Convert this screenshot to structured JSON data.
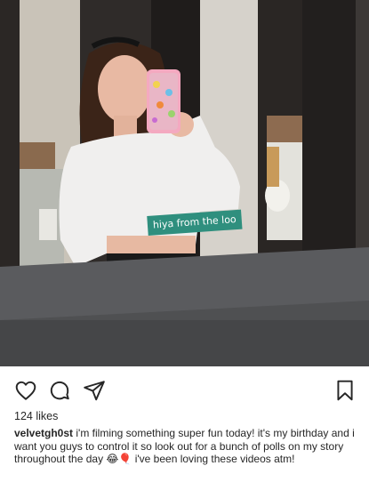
{
  "post": {
    "photo_overlay_text": "hiya from the loo",
    "likes": "124 likes",
    "username": "velvetgh0st",
    "caption": "i'm filming something super fun today! it's my birthday and i want you guys to control it so look out for a bunch of polls on my story throughout the day 😂🎈 i've been loving these videos atm!"
  },
  "icons": {
    "like": "heart-icon",
    "comment": "comment-icon",
    "share": "share-icon",
    "save": "bookmark-icon"
  }
}
